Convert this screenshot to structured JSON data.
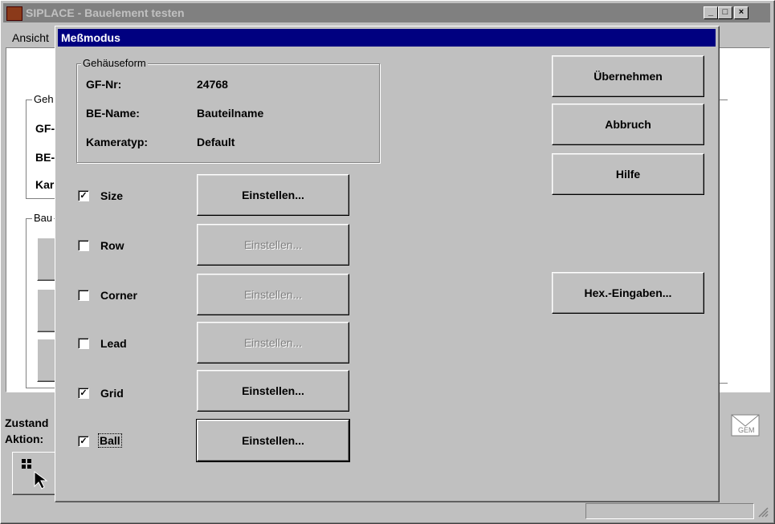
{
  "main_window": {
    "title": "SIPLACE - Bauelement testen",
    "menu": [
      "Ansicht"
    ],
    "group1_label": "Geh",
    "field_labels": [
      "GF-",
      "BE-",
      "Kar"
    ],
    "group2_label": "Bau",
    "zustand_label": "Zustand",
    "aktion_label": "Aktion:",
    "gem_label": "GEM"
  },
  "dialog": {
    "title": "Meßmodus",
    "group_label": "Gehäuseform",
    "fields": [
      {
        "label": "GF-Nr:",
        "value": "24768"
      },
      {
        "label": "BE-Name:",
        "value": "Bauteilname"
      },
      {
        "label": "Kameratyp:",
        "value": "Default"
      }
    ],
    "modes": [
      {
        "label": "Size",
        "checked": true,
        "button": "Einstellen...",
        "enabled": true
      },
      {
        "label": "Row",
        "checked": false,
        "button": "Einstellen...",
        "enabled": false
      },
      {
        "label": "Corner",
        "checked": false,
        "button": "Einstellen...",
        "enabled": false
      },
      {
        "label": "Lead",
        "checked": false,
        "button": "Einstellen...",
        "enabled": false
      },
      {
        "label": "Grid",
        "checked": true,
        "button": "Einstellen...",
        "enabled": true
      },
      {
        "label": "Ball",
        "checked": true,
        "button": "Einstellen...",
        "enabled": true
      }
    ],
    "buttons": {
      "apply": "Übernehmen",
      "cancel": "Abbruch",
      "help": "Hilfe",
      "hex": "Hex.-Eingaben..."
    }
  },
  "colors": {
    "active_title": "#000080",
    "inactive_title": "#808080",
    "face": "#c0c0c0"
  }
}
